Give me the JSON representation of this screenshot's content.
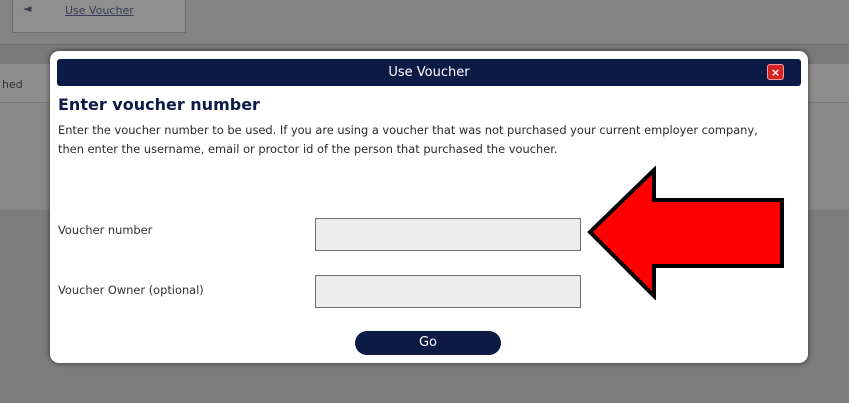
{
  "background": {
    "tab_link": "Use Voucher",
    "panel_text": "hed"
  },
  "dialog": {
    "title": "Use Voucher",
    "close_symbol": "×",
    "heading": "Enter voucher number",
    "instructions": "Enter the voucher number to be used. If you are using a voucher that was not purchased your current employer company, then enter the username, email or proctor id of the person that purchased the voucher.",
    "fields": {
      "voucher_number_label": "Voucher number",
      "voucher_number_value": "",
      "voucher_owner_label": "Voucher Owner (optional)",
      "voucher_owner_value": ""
    },
    "go_label": "Go"
  },
  "colors": {
    "titlebar": "#0c1b46",
    "close_button": "#d42525",
    "annotation_arrow": "#ff0000",
    "input_fill": "#ececec"
  },
  "icons": {
    "close": "close-icon",
    "annotation": "red-arrow-icon"
  }
}
